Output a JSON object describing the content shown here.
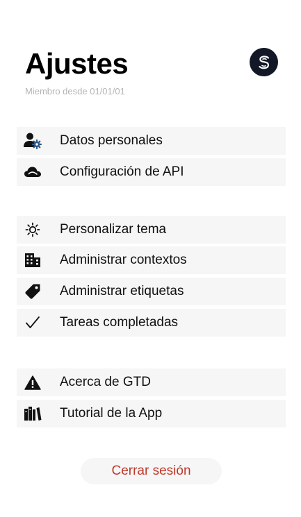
{
  "header": {
    "title": "Ajustes",
    "member_since": "Miembro desde 01/01/01"
  },
  "avatar": {
    "icon": "s-logo-icon",
    "color": "#121826"
  },
  "groups": [
    {
      "items": [
        {
          "label": "Datos personales",
          "icon": "user-gear-icon"
        },
        {
          "label": "Configuración de API",
          "icon": "cloud-icon"
        }
      ]
    },
    {
      "items": [
        {
          "label": "Personalizar tema",
          "icon": "sun-icon"
        },
        {
          "label": "Administrar contextos",
          "icon": "building-icon"
        },
        {
          "label": "Administrar etiquetas",
          "icon": "tag-icon"
        },
        {
          "label": "Tareas completadas",
          "icon": "checkmark-icon"
        }
      ]
    },
    {
      "items": [
        {
          "label": "Acerca de GTD",
          "icon": "warning-icon"
        },
        {
          "label": "Tutorial de la App",
          "icon": "books-icon"
        }
      ]
    }
  ],
  "logout_label": "Cerrar sesión",
  "colors": {
    "row_background": "#f6f6f6",
    "logout_text": "#c0392b",
    "subtitle_text": "#b5b5b5"
  }
}
